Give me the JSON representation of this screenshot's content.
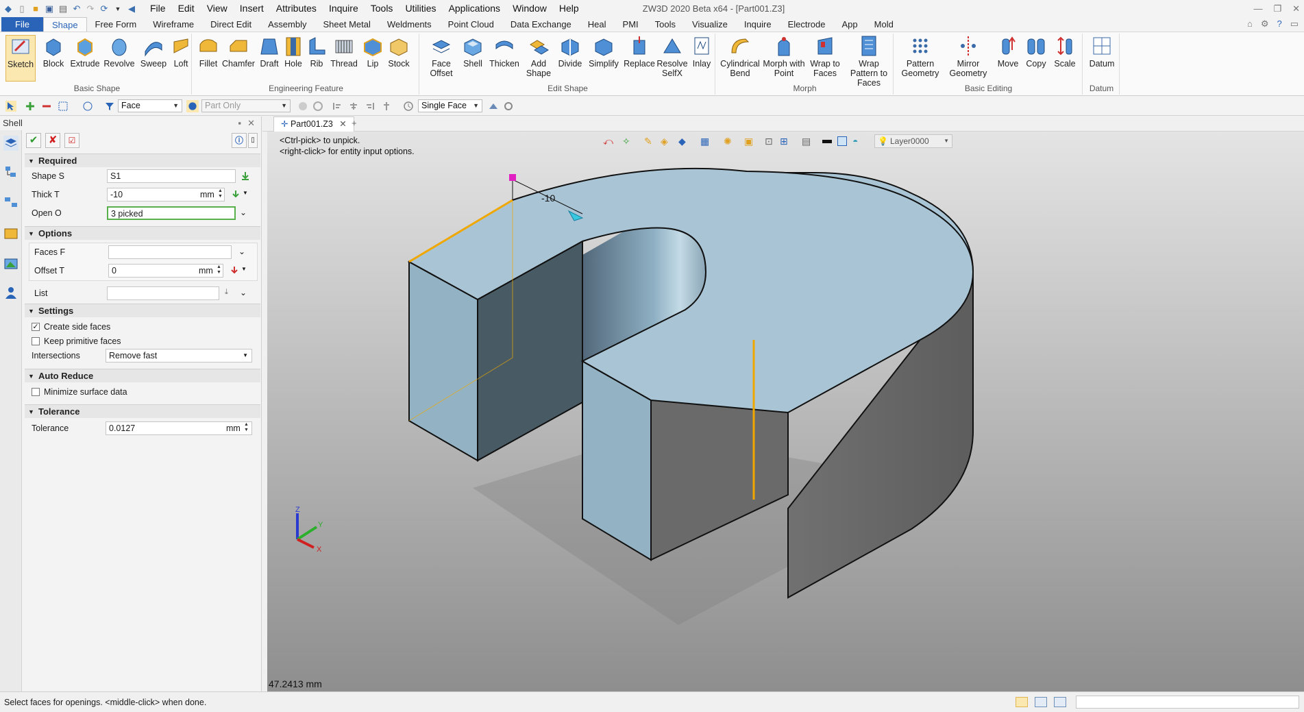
{
  "app": {
    "title": "ZW3D 2020 Beta x64 - [Part001.Z3]",
    "menu": [
      "File",
      "Edit",
      "View",
      "Insert",
      "Attributes",
      "Inquire",
      "Tools",
      "Utilities",
      "Applications",
      "Window",
      "Help"
    ]
  },
  "ribbon_tabs": [
    "File",
    "Shape",
    "Free Form",
    "Wireframe",
    "Direct Edit",
    "Assembly",
    "Sheet Metal",
    "Weldments",
    "Point Cloud",
    "Data Exchange",
    "Heal",
    "PMI",
    "Tools",
    "Visualize",
    "Inquire",
    "Electrode",
    "App",
    "Mold"
  ],
  "ribbon_groups": {
    "basic_shape": {
      "label": "Basic Shape",
      "buttons": [
        "Sketch",
        "Block",
        "Extrude",
        "Revolve",
        "Sweep",
        "Loft"
      ]
    },
    "engineering_feature": {
      "label": "Engineering Feature",
      "buttons": [
        "Fillet",
        "Chamfer",
        "Draft",
        "Hole",
        "Rib",
        "Thread",
        "Lip",
        "Stock"
      ]
    },
    "edit_shape": {
      "label": "Edit Shape",
      "buttons": [
        "Face Offset",
        "Shell",
        "Thicken",
        "Add Shape",
        "Divide",
        "Simplify",
        "Replace",
        "Resolve SelfX",
        "Inlay"
      ]
    },
    "morph": {
      "label": "Morph",
      "buttons": [
        "Cylindrical Bend",
        "Morph with Point",
        "Wrap to Faces",
        "Wrap Pattern to Faces"
      ]
    },
    "basic_editing": {
      "label": "Basic Editing",
      "buttons": [
        "Pattern Geometry",
        "Mirror Geometry",
        "Move",
        "Copy",
        "Scale"
      ]
    },
    "datum": {
      "label": "Datum",
      "buttons": [
        "Datum"
      ]
    }
  },
  "toolbar": {
    "filter": "Face",
    "scope": "Part Only",
    "pick_mode": "Single Face"
  },
  "panel": {
    "title": "Shell",
    "required": {
      "header": "Required",
      "shape_label": "Shape S",
      "shape_value": "S1",
      "thick_label": "Thick T",
      "thick_value": "-10",
      "thick_unit": "mm",
      "open_label": "Open O",
      "open_value": "3 picked"
    },
    "options": {
      "header": "Options",
      "faces_label": "Faces F",
      "faces_value": "",
      "offset_label": "Offset T",
      "offset_value": "0",
      "offset_unit": "mm",
      "list_label": "List",
      "list_value": ""
    },
    "settings": {
      "header": "Settings",
      "create_side_faces": "Create side faces",
      "create_side_faces_checked": true,
      "keep_primitive_faces": "Keep primitive faces",
      "keep_primitive_faces_checked": false,
      "intersections_label": "Intersections",
      "intersections_value": "Remove fast"
    },
    "auto_reduce": {
      "header": "Auto Reduce",
      "minimize_label": "Minimize surface data",
      "minimize_checked": false
    },
    "tolerance": {
      "header": "Tolerance",
      "label": "Tolerance",
      "value": "0.0127",
      "unit": "mm"
    }
  },
  "document": {
    "tab": "Part001.Z3",
    "hint1": "<Ctrl-pick> to unpick.",
    "hint2": "<right-click> for entity input options.",
    "layer": "Layer0000",
    "dimension": "-10",
    "measure": "47.2413 mm",
    "axes": {
      "z": "Z",
      "y": "Y",
      "x": "X"
    }
  },
  "status": {
    "text": "Select faces for openings.  <middle-click> when done."
  },
  "colors": {
    "accent": "#2a64b8",
    "model_face": "#a9c4d4",
    "selected_edge": "#f0a800",
    "highlight_field": "#57b04a"
  }
}
